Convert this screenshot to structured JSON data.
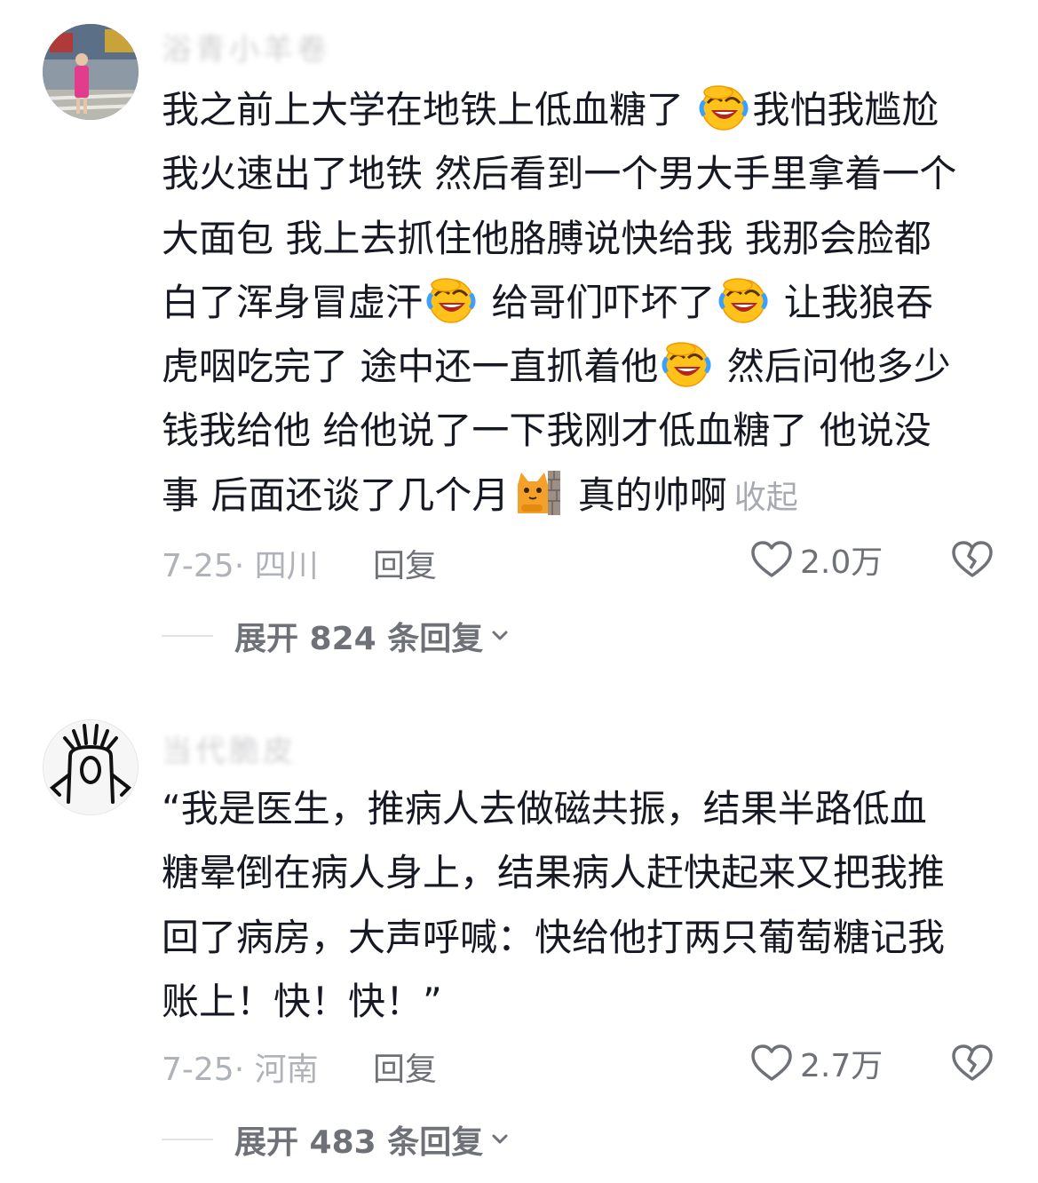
{
  "comments": [
    {
      "username": "浴青小羊卷",
      "lines": [
        "我之前上大学在地铁上低血糖了 ",
        "我怕我尴尬",
        "我火速出了地铁 然后看到一个男大手里拿着一个",
        "大面包 我上去抓住他胳膊说快给我 我那会脸都",
        "白了浑身冒虚汗",
        " 给哥们吓坏了",
        " 让我狼吞",
        "虎咽吃完了 途中还一直抓着他",
        " 然后问他多少",
        "钱我给他 给他说了一下我刚才低血糖了 他说没",
        "事 后面还谈了几个月",
        " 真的帅啊"
      ],
      "collapse_label": "收起",
      "date_location": "7-25· 四川",
      "reply_label": "回复",
      "like_count": "2.0万",
      "expand_label": "展开 824 条回复",
      "emoji_names": [
        "laugh-cry-emoji",
        "laugh-cry-emoji",
        "laugh-cry-emoji",
        "laugh-cry-emoji",
        "cat-wall-emoji"
      ]
    },
    {
      "username": "当代脆皮",
      "lines": [
        "“我是医生，推病人去做磁共振，结果半路低血",
        "糖晕倒在病人身上，结果病人赶快起来又把我推",
        "回了病房，大声呼喊：快给他打两只葡萄糖记我",
        "账上！快！快！”"
      ],
      "date_location": "7-25· 河南",
      "reply_label": "回复",
      "like_count": "2.7万",
      "expand_label": "展开 483 条回复"
    }
  ],
  "colors": {
    "text": "#161823",
    "secondary": "#6f7179",
    "muted": "#b0b2b9"
  }
}
